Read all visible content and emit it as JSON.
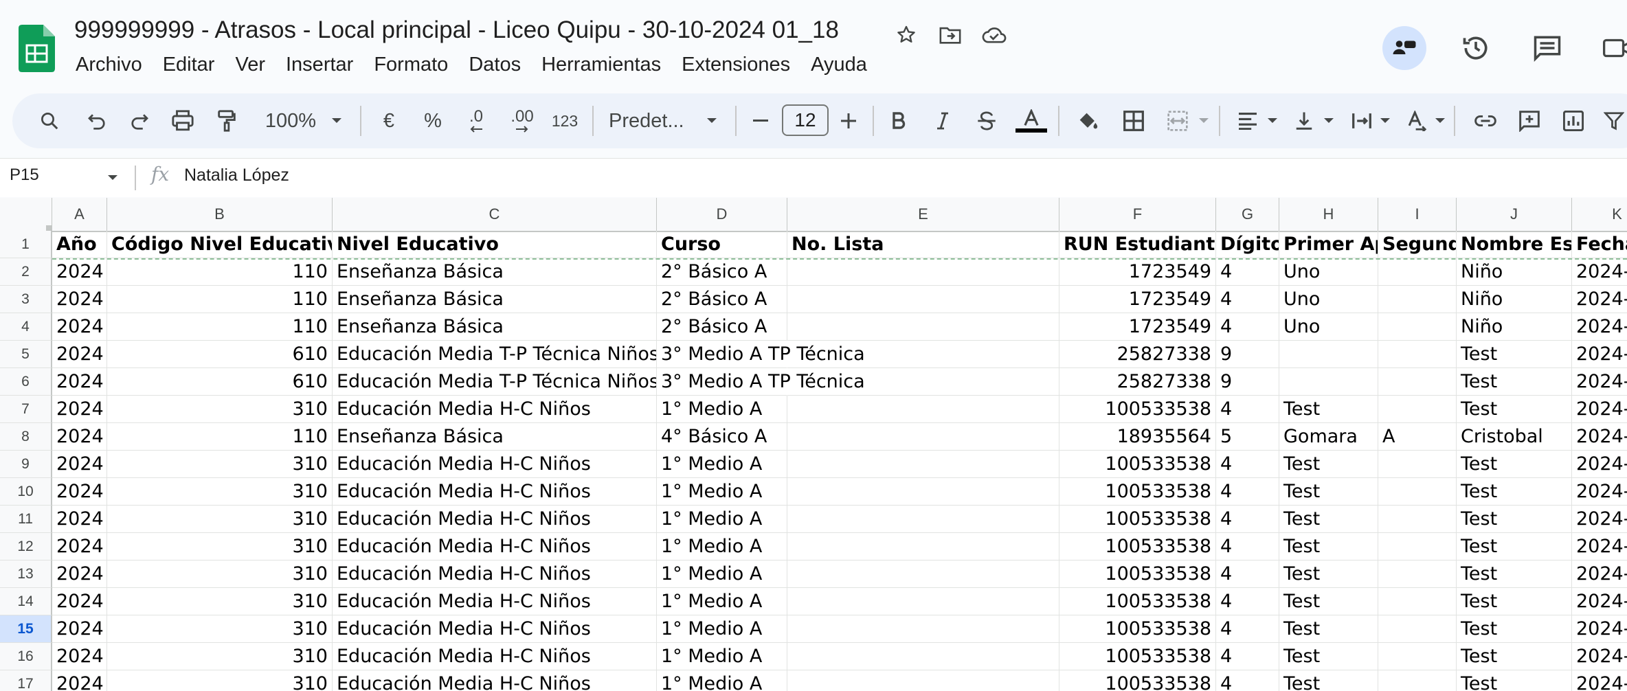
{
  "window": {
    "doc_title": "999999999 - Atrasos - Local principal - Liceo Quipu - 30-10-2024 01_18"
  },
  "menu": [
    "Archivo",
    "Editar",
    "Ver",
    "Insertar",
    "Formato",
    "Datos",
    "Herramientas",
    "Extensiones",
    "Ayuda"
  ],
  "toolbar": {
    "zoom": "100%",
    "currency": "€",
    "percent": "%",
    "dec_decrease": ".0",
    "dec_increase": ".00",
    "format_more": "123",
    "font_name": "Predet...",
    "font_size": "12"
  },
  "formula_bar": {
    "cell_ref": "P15",
    "fx": "fx",
    "value": "Natalia López"
  },
  "columns": [
    "A",
    "B",
    "C",
    "D",
    "E",
    "F",
    "G",
    "H",
    "I",
    "J",
    "K"
  ],
  "header_row": [
    "Año",
    "Código Nivel Educativo",
    "Nivel Educativo",
    "Curso",
    "No. Lista",
    "RUN Estudiante",
    "Dígito",
    "Primer Ap",
    "Segundo",
    "Nombre Est",
    "Fecha"
  ],
  "rows": [
    {
      "n": "2",
      "cells": [
        "2024",
        "110",
        "Enseñanza Básica",
        "2° Básico A",
        "",
        "1723549",
        "4",
        "Uno",
        "",
        "Niño",
        "2024-"
      ]
    },
    {
      "n": "3",
      "cells": [
        "2024",
        "110",
        "Enseñanza Básica",
        "2° Básico A",
        "",
        "1723549",
        "4",
        "Uno",
        "",
        "Niño",
        "2024-"
      ]
    },
    {
      "n": "4",
      "cells": [
        "2024",
        "110",
        "Enseñanza Básica",
        "2° Básico A",
        "",
        "1723549",
        "4",
        "Uno",
        "",
        "Niño",
        "2024-"
      ]
    },
    {
      "n": "5",
      "cells": [
        "2024",
        "610",
        "Educación Media T-P Técnica Niños",
        "3° Medio A TP Técnica",
        "",
        "25827338",
        "9",
        "",
        "",
        "Test",
        "2024-"
      ]
    },
    {
      "n": "6",
      "cells": [
        "2024",
        "610",
        "Educación Media T-P Técnica Niños",
        "3° Medio A TP Técnica",
        "",
        "25827338",
        "9",
        "",
        "",
        "Test",
        "2024-"
      ]
    },
    {
      "n": "7",
      "cells": [
        "2024",
        "310",
        "Educación Media H-C Niños",
        "1° Medio A",
        "",
        "100533538",
        "4",
        "Test",
        "",
        "Test",
        "2024-"
      ]
    },
    {
      "n": "8",
      "cells": [
        "2024",
        "110",
        "Enseñanza Básica",
        "4° Básico A",
        "",
        "18935564",
        "5",
        "Gomara",
        "A",
        "Cristobal",
        "2024-"
      ]
    },
    {
      "n": "9",
      "cells": [
        "2024",
        "310",
        "Educación Media H-C Niños",
        "1° Medio A",
        "",
        "100533538",
        "4",
        "Test",
        "",
        "Test",
        "2024-"
      ]
    },
    {
      "n": "10",
      "cells": [
        "2024",
        "310",
        "Educación Media H-C Niños",
        "1° Medio A",
        "",
        "100533538",
        "4",
        "Test",
        "",
        "Test",
        "2024-"
      ]
    },
    {
      "n": "11",
      "cells": [
        "2024",
        "310",
        "Educación Media H-C Niños",
        "1° Medio A",
        "",
        "100533538",
        "4",
        "Test",
        "",
        "Test",
        "2024-"
      ]
    },
    {
      "n": "12",
      "cells": [
        "2024",
        "310",
        "Educación Media H-C Niños",
        "1° Medio A",
        "",
        "100533538",
        "4",
        "Test",
        "",
        "Test",
        "2024-"
      ]
    },
    {
      "n": "13",
      "cells": [
        "2024",
        "310",
        "Educación Media H-C Niños",
        "1° Medio A",
        "",
        "100533538",
        "4",
        "Test",
        "",
        "Test",
        "2024-"
      ]
    },
    {
      "n": "14",
      "cells": [
        "2024",
        "310",
        "Educación Media H-C Niños",
        "1° Medio A",
        "",
        "100533538",
        "4",
        "Test",
        "",
        "Test",
        "2024-"
      ]
    },
    {
      "n": "15",
      "cells": [
        "2024",
        "310",
        "Educación Media H-C Niños",
        "1° Medio A",
        "",
        "100533538",
        "4",
        "Test",
        "",
        "Test",
        "2024-"
      ],
      "selected": true
    },
    {
      "n": "16",
      "cells": [
        "2024",
        "310",
        "Educación Media H-C Niños",
        "1° Medio A",
        "",
        "100533538",
        "4",
        "Test",
        "",
        "Test",
        "2024-"
      ]
    },
    {
      "n": "17",
      "cells": [
        "2024",
        "310",
        "Educación Media H-C Niños",
        "1° Medio A",
        "",
        "100533538",
        "4",
        "Test",
        "",
        "Test",
        "2024-"
      ]
    }
  ],
  "header_row_number": "1",
  "colors": {
    "sheets_green": "#0f9d58",
    "toolbar_bg": "#edf2fa",
    "selection_blue": "#d3e3fd"
  }
}
